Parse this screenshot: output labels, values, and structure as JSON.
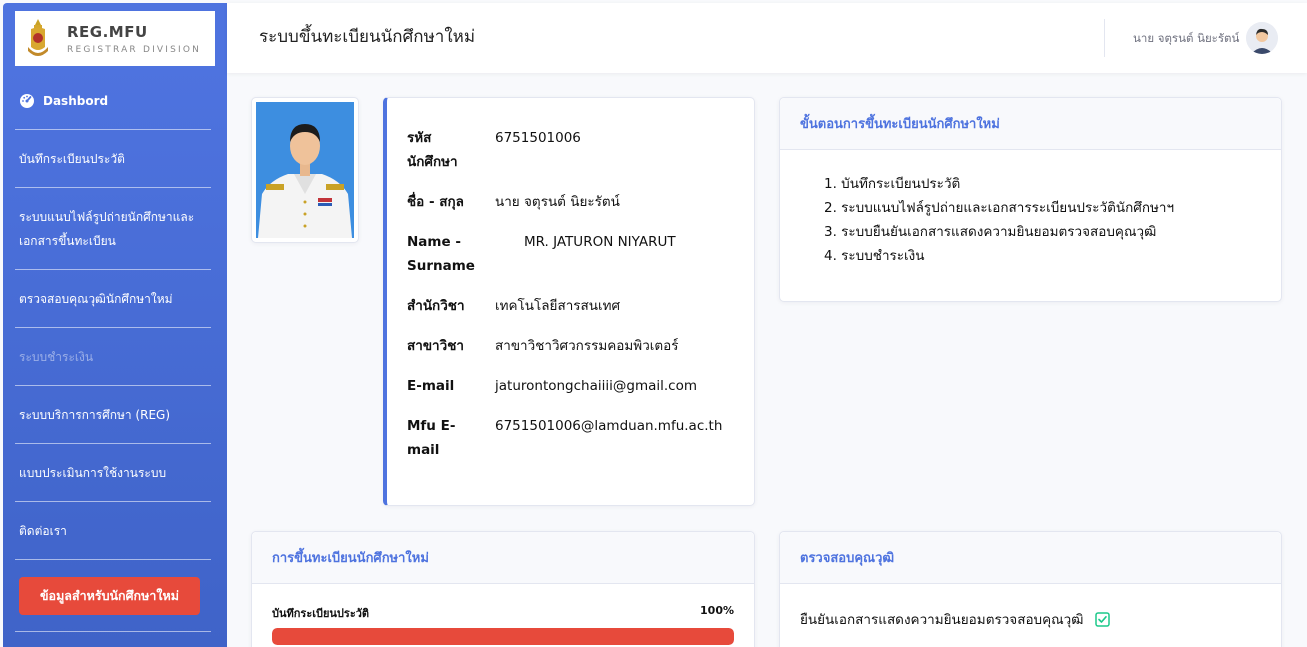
{
  "sidebar": {
    "logo_title": "REG.MFU",
    "logo_sub": "REGISTRAR DIVISION",
    "dashboard": "Dashbord",
    "items": [
      {
        "label": "บันทึกระเบียนประวัติ"
      },
      {
        "label": "ระบบแนบไฟล์รูปถ่ายนักศึกษาและเอกสารขึ้นทะเบียน"
      },
      {
        "label": "ตรวจสอบคุณวุฒินักศึกษาใหม่"
      },
      {
        "label": "ระบบชำระเงิน"
      },
      {
        "label": "ระบบบริการการศึกษา (REG)"
      },
      {
        "label": "แบบประเมินการใช้งานระบบ"
      },
      {
        "label": "ติดต่อเรา"
      }
    ],
    "cta_label": "ข้อมูลสำหรับนักศึกษาใหม่"
  },
  "topbar": {
    "title": "ระบบขึ้นทะเบียนนักศึกษาใหม่",
    "user_name": "นาย จตุรนต์ นิยะรัตน์"
  },
  "profile": {
    "student_id_label": "รหัสนักศึกษา",
    "student_id": "6751501006",
    "name_th_label": "ชื่อ - สกุล",
    "name_th": "นาย จตุรนต์ นิยะรัตน์",
    "name_en_label": "Name - Surname",
    "name_en": "MR. JATURON NIYARUT",
    "school_label": "สำนักวิชา",
    "school": "เทคโนโลยีสารสนเทศ",
    "major_label": "สาขาวิชา",
    "major": "สาขาวิชาวิศวกรรมคอมพิวเตอร์",
    "email_label": "E-mail",
    "email": "jaturontongchaiiii@gmail.com",
    "mfu_email_label": "Mfu E-mail",
    "mfu_email": "6751501006@lamduan.mfu.ac.th"
  },
  "steps": {
    "header": "ขั้นตอนการขึ้นทะเบียนนักศึกษาใหม่",
    "items": [
      "1. บันทึกระเบียนประวัติ",
      "2. ระบบแนบไฟล์รูปถ่ายและเอกสารระเบียนประวัตินักศึกษาฯ",
      "3. ระบบยืนยันเอกสารแสดงความยินยอมตรวจสอบคุณวุฒิ",
      "4. ระบบชำระเงิน"
    ]
  },
  "registration": {
    "header": "การขึ้นทะเบียนนักศึกษาใหม่",
    "progress_label": "บันทึกระเบียนประวัติ",
    "progress_text": "100%",
    "progress_fraction": 1.0,
    "bar_color": "#e74a3b"
  },
  "verification": {
    "header": "ตรวจสอบคุณวุฒิ",
    "item_text": "ยืนยันเอกสารแสดงความยินยอมตรวจสอบคุณวุฒิ",
    "icon": "checkbox-checked-icon"
  },
  "colors": {
    "primary": "#4e73df",
    "danger": "#e74a3b",
    "success": "#1cc88a"
  }
}
